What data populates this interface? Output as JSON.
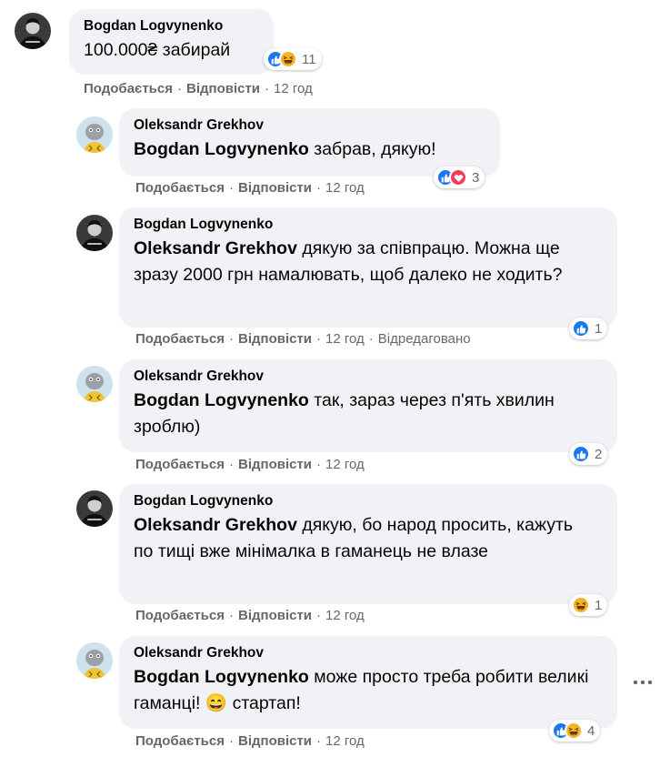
{
  "comments": [
    {
      "author": "Bogdan Logvynenko",
      "mention": "",
      "text": "100.000₴ забирай",
      "reactions": [
        "like",
        "haha"
      ],
      "reaction_count": "11",
      "like_label": "Подобається",
      "reply_label": "Відповісти",
      "time": "12 год",
      "edited": ""
    },
    {
      "author": "Oleksandr Grekhov",
      "mention": "Bogdan Logvynenko",
      "text": "забрав, дякую!",
      "reactions": [
        "like",
        "love"
      ],
      "reaction_count": "3",
      "like_label": "Подобається",
      "reply_label": "Відповісти",
      "time": "12 год",
      "edited": ""
    },
    {
      "author": "Bogdan Logvynenko",
      "mention": "Oleksandr Grekhov",
      "text": "дякую за співпрацю. Можна ще зразу 2000 грн намалювать, щоб далеко не ходить?",
      "reactions": [
        "like"
      ],
      "reaction_count": "1",
      "like_label": "Подобається",
      "reply_label": "Відповісти",
      "time": "12 год",
      "edited": "Відредаговано"
    },
    {
      "author": "Oleksandr Grekhov",
      "mention": "Bogdan Logvynenko",
      "text": "так, зараз через п'ять хвилин зроблю)",
      "reactions": [
        "like"
      ],
      "reaction_count": "2",
      "like_label": "Подобається",
      "reply_label": "Відповісти",
      "time": "12 год",
      "edited": ""
    },
    {
      "author": "Bogdan Logvynenko",
      "mention": "Oleksandr Grekhov",
      "text": "дякую, бо народ просить, кажуть по тищі вже мінімалка в гаманець не влазе",
      "reactions": [
        "haha"
      ],
      "reaction_count": "1",
      "like_label": "Подобається",
      "reply_label": "Відповісти",
      "time": "12 год",
      "edited": ""
    },
    {
      "author": "Oleksandr Grekhov",
      "mention": "Bogdan Logvynenko",
      "text": "може просто треба робити великі гаманці! 😄 стартап!",
      "reactions": [
        "like",
        "haha"
      ],
      "reaction_count": "4",
      "like_label": "Подобається",
      "reply_label": "Відповісти",
      "time": "12 год",
      "edited": ""
    }
  ],
  "colors": {
    "bubble": "#f0f2f5",
    "meta_text": "#65676b",
    "like": "#1877f2",
    "love": "#f33e58",
    "haha": "#f7b125"
  },
  "icons": [
    "like-reaction-icon",
    "love-reaction-icon",
    "haha-reaction-icon",
    "more-options-icon"
  ]
}
